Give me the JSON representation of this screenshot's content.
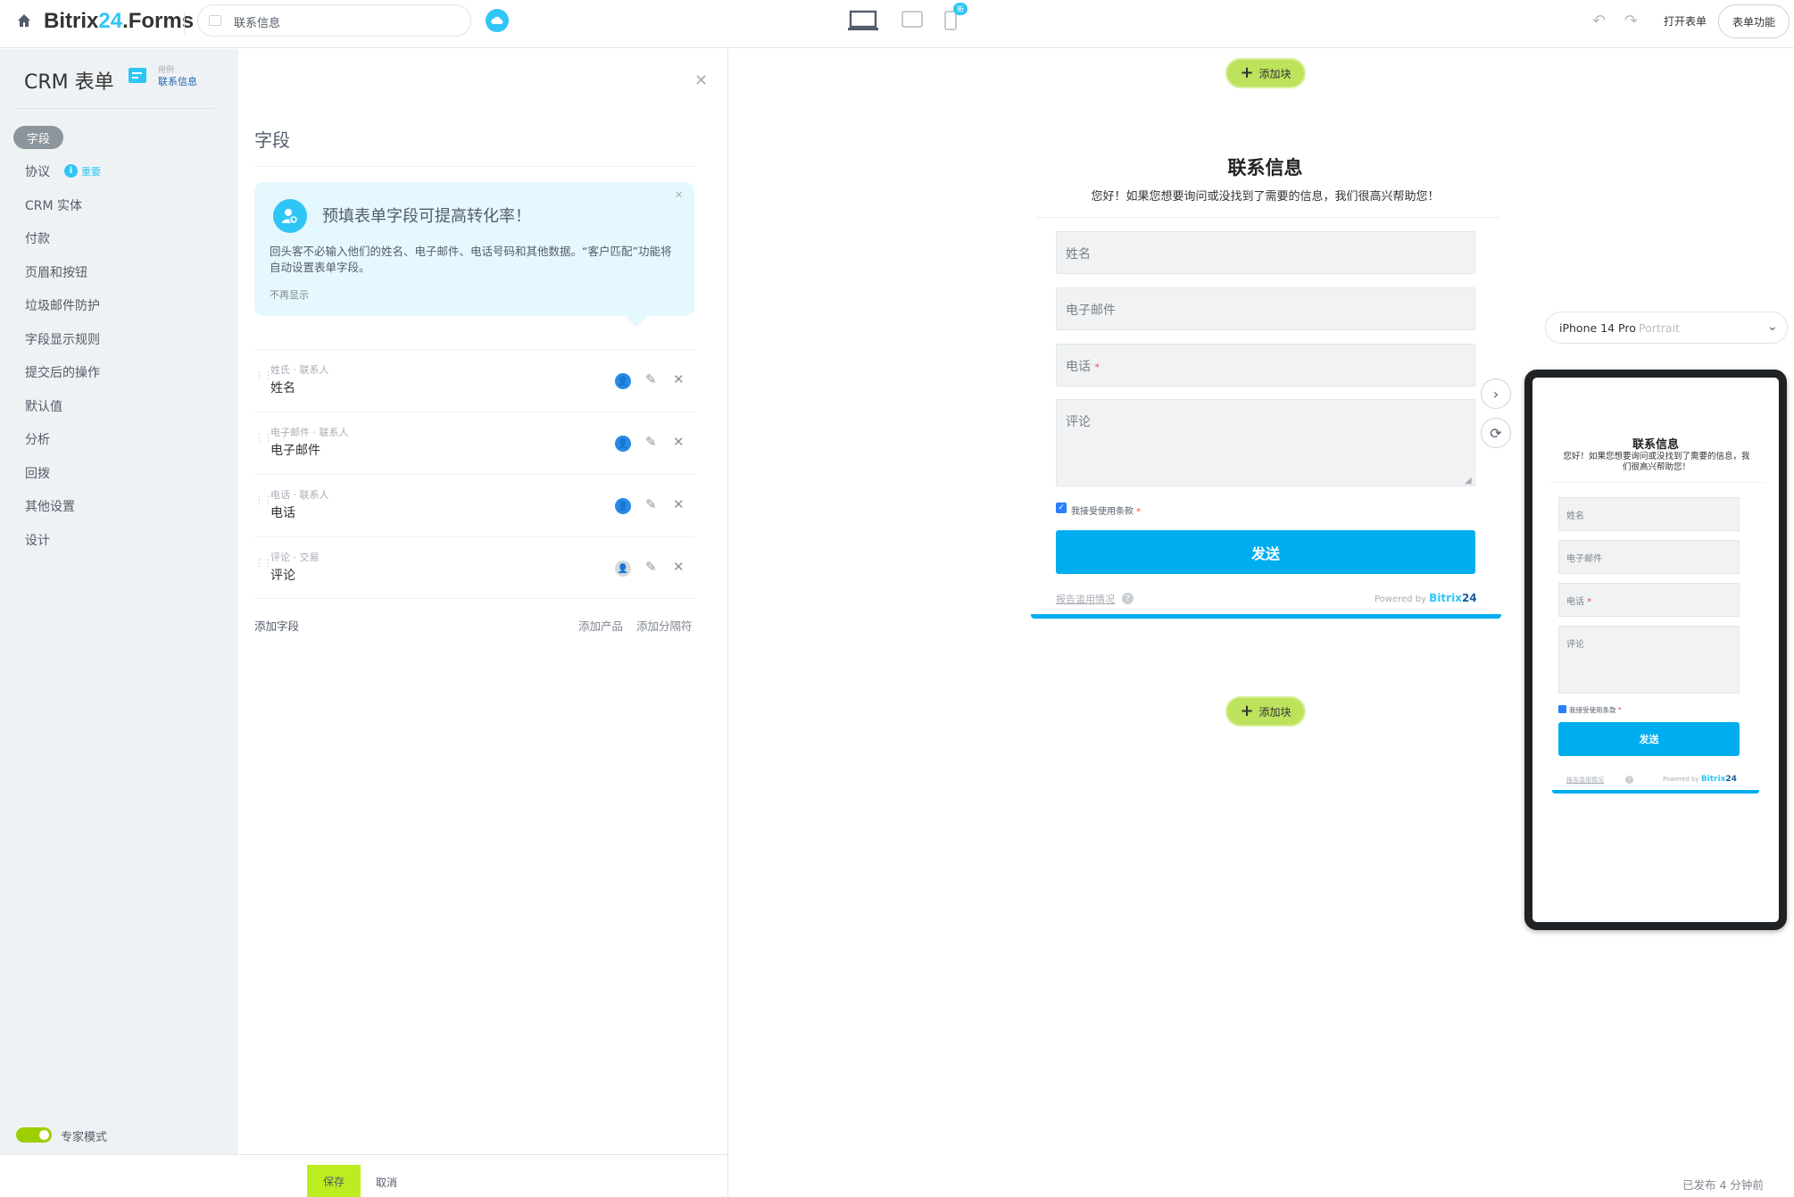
{
  "topbar": {
    "logo_part1": "Bitrix",
    "logo_part2": "24",
    "logo_part3": ".Forms",
    "form_name": "联系信息",
    "open_form": "打开表单",
    "form_features": "表单功能",
    "mobile_badge": "新"
  },
  "sidebar": {
    "title": "CRM 表单",
    "example_label": "用例",
    "example_value": "联系信息",
    "items": [
      {
        "label": "字段"
      },
      {
        "label": "协议",
        "badge": "重要"
      },
      {
        "label": "CRM 实体"
      },
      {
        "label": "付款"
      },
      {
        "label": "页眉和按钮"
      },
      {
        "label": "垃圾邮件防护"
      },
      {
        "label": "字段显示规则"
      },
      {
        "label": "提交后的操作"
      },
      {
        "label": "默认值"
      },
      {
        "label": "分析"
      },
      {
        "label": "回拨"
      },
      {
        "label": "其他设置"
      },
      {
        "label": "设计"
      }
    ],
    "expert_mode": "专家模式"
  },
  "panel": {
    "title": "字段",
    "hint_title": "预填表单字段可提高转化率！",
    "hint_text": "回头客不必输入他们的姓名、电子邮件、电话号码和其他数据。“客户匹配”功能将自动设置表单字段。",
    "hint_dismiss": "不再显示",
    "fields": [
      {
        "sub": "姓氏 · 联系人",
        "name": "姓名"
      },
      {
        "sub": "电子邮件 · 联系人",
        "name": "电子邮件"
      },
      {
        "sub": "电话 · 联系人",
        "name": "电话"
      },
      {
        "sub": "评论 · 交易",
        "name": "评论"
      }
    ],
    "add_field": "添加字段",
    "add_product": "添加产品",
    "add_separator": "添加分隔符"
  },
  "bottombar": {
    "save": "保存",
    "cancel": "取消"
  },
  "preview": {
    "add_block": "添加块",
    "form_title": "联系信息",
    "form_subtitle": "您好！如果您想要询问或没找到了需要的信息，我们很高兴帮助您！",
    "name_ph": "姓名",
    "email_ph": "电子邮件",
    "phone_ph": "电话",
    "comment_ph": "评论",
    "consent": "我接受使用条款",
    "submit": "发送",
    "report_abuse": "报告滥用情况",
    "powered_by": "Powered by",
    "brand": "Bitrix",
    "brand_num": "24",
    "device_name": "iPhone 14 Pro",
    "device_orientation": "Portrait",
    "published": "已发布 4 分钟前",
    "required_mark": "*"
  },
  "colors": {
    "accent": "#2fc6f6",
    "submit": "#00aeef",
    "add_block": "#bde25c",
    "save": "#bbed21"
  }
}
